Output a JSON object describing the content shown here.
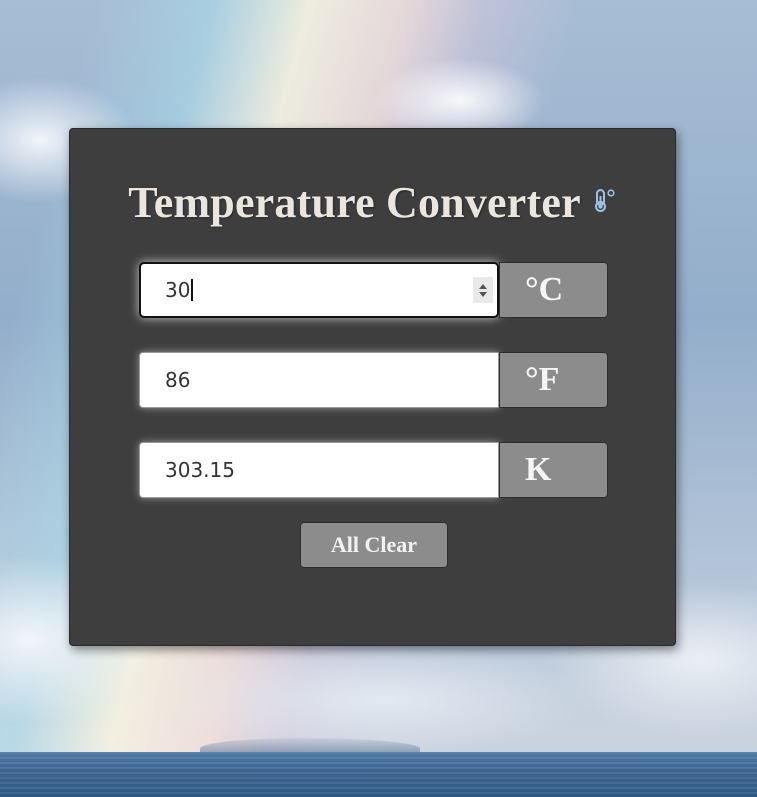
{
  "app": {
    "title": "Temperature Converter",
    "title_icon": "thermometer-icon"
  },
  "converter": {
    "celsius": {
      "value": "30",
      "unit_label": "°C",
      "focused": true
    },
    "fahrenheit": {
      "value": "86",
      "unit_label": "°F"
    },
    "kelvin": {
      "value": "303.15",
      "unit_label": "K"
    }
  },
  "actions": {
    "clear_label": "All Clear"
  },
  "colors": {
    "card_background": "#3e3e3e",
    "unit_background": "#8c8c8c",
    "title_text": "#e9e6df",
    "icon_color": "#9fc3e6"
  }
}
